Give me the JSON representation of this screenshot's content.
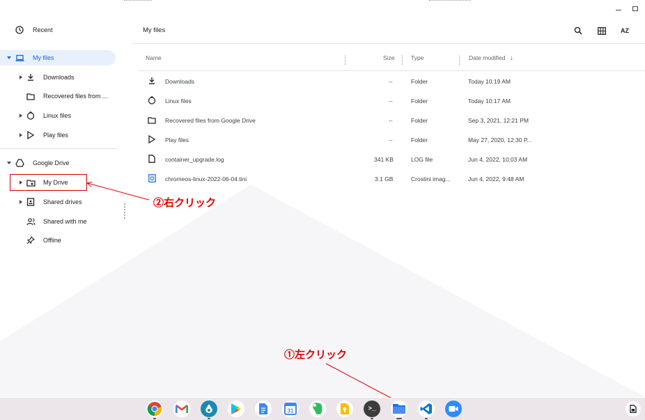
{
  "sidebar": {
    "recent": "Recent",
    "my_files": "My files",
    "downloads": "Downloads",
    "recovered": "Recovered files from ...",
    "linux": "Linux files",
    "play": "Play files",
    "google_drive": "Google Drive",
    "my_drive": "My Drive",
    "shared_drives": "Shared drives",
    "shared_with_me": "Shared with me",
    "offline": "Offline"
  },
  "header": {
    "title": "My files",
    "search_icon": "search-icon",
    "grid_icon": "grid-view-icon",
    "sort_icon": "sort-az-icon",
    "sort_label": "AZ"
  },
  "columns": {
    "name": "Name",
    "size": "Size",
    "type": "Type",
    "date": "Date modified",
    "sort_arrow": "↓"
  },
  "files": [
    {
      "name": "Downloads",
      "size": "--",
      "type": "Folder",
      "date": "Today 10:19 AM",
      "icon": "download-icon"
    },
    {
      "name": "Linux files",
      "size": "--",
      "type": "Folder",
      "date": "Today 10:17 AM",
      "icon": "linux-icon"
    },
    {
      "name": "Recovered files from Google Drive",
      "size": "--",
      "type": "Folder",
      "date": "Sep 3, 2021, 12:21 PM",
      "icon": "folder-icon"
    },
    {
      "name": "Play files",
      "size": "--",
      "type": "Folder",
      "date": "May 27, 2020, 12:30 P...",
      "icon": "play-icon"
    },
    {
      "name": "container_upgrade.log",
      "size": "341 KB",
      "type": "LOG file",
      "date": "Jun 4, 2022, 10:03 AM",
      "icon": "file-icon"
    },
    {
      "name": "chromeos-linux-2022-06-04.tini",
      "size": "3.1 GB",
      "type": "Crostini imag...",
      "date": "Jun 4, 2022, 9:48 AM",
      "icon": "crostini-icon"
    }
  ],
  "annotations": {
    "right_click": "②右クリック",
    "left_click": "①左クリック"
  },
  "shelf": {
    "apps": [
      "chrome-icon",
      "gmail-icon",
      "inkscape-icon",
      "play-store-icon",
      "docs-icon",
      "calendar-icon",
      "evernote-icon",
      "keep-icon",
      "terminal-icon",
      "files-icon",
      "vscode-icon",
      "zoom-icon"
    ],
    "terminal_glyph": ">_"
  },
  "colors": {
    "accent": "#1967d2",
    "selected_bg": "#e8f0fe",
    "annotation": "#e00000",
    "shelf_bg": "#ece6ea"
  }
}
